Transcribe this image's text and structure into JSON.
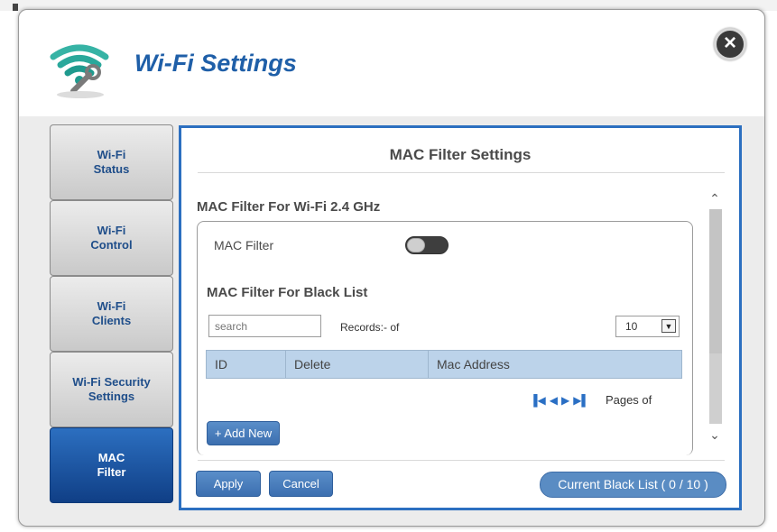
{
  "dialog": {
    "title": "Wi-Fi Settings",
    "close_icon": "close-icon"
  },
  "sidebar": {
    "items": [
      {
        "label": "Wi-Fi\nStatus"
      },
      {
        "label": "Wi-Fi\nControl"
      },
      {
        "label": "Wi-Fi\nClients"
      },
      {
        "label": "Wi-Fi Security\nSettings"
      },
      {
        "label": "MAC\nFilter",
        "active": true
      }
    ]
  },
  "content": {
    "title": "MAC Filter Settings",
    "section_title": "MAC Filter For Wi-Fi 2.4 GHz",
    "mac_filter_label": "MAC Filter",
    "mac_filter_enabled": false,
    "blacklist_title": "MAC Filter For Black List",
    "search_placeholder": "search",
    "records_label": "Records:- of",
    "page_size": "10",
    "table_headers": [
      "ID",
      "Delete",
      "Mac Address"
    ],
    "pages_label": "Pages of",
    "add_new_label": "+ Add New",
    "apply_label": "Apply",
    "cancel_label": "Cancel",
    "current_list_label": "Current Black List ( 0 / 10 )"
  },
  "colors": {
    "accent": "#2c6fc0",
    "title": "#1f5fa8",
    "table_header_bg": "#bcd3ea"
  }
}
